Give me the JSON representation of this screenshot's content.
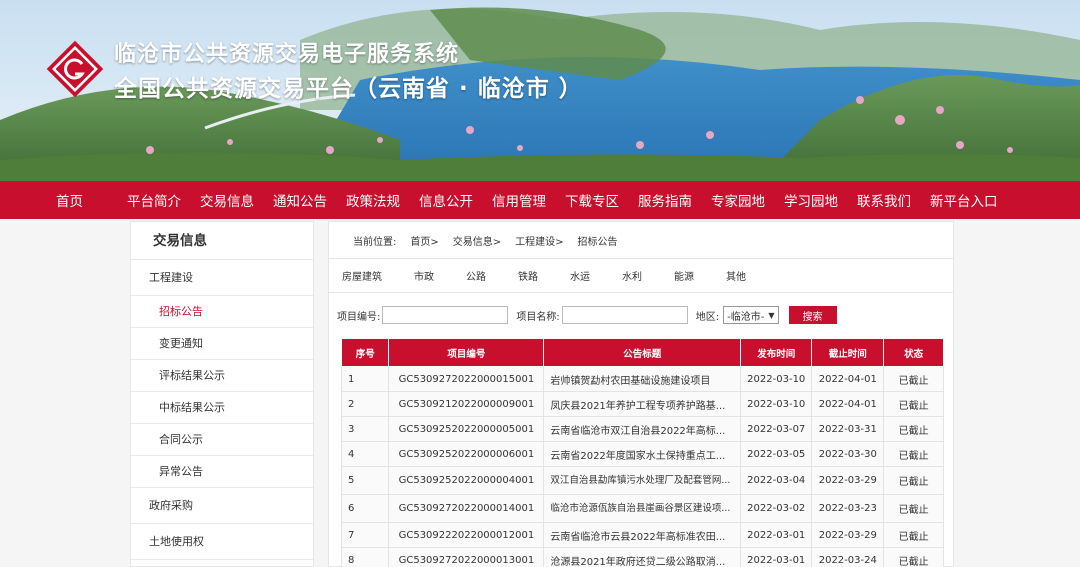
{
  "header": {
    "title_line1": "临沧市公共资源交易电子服务系统",
    "title_line2": "全国公共资源交易平台（云南省 · 临沧市 ）"
  },
  "nav": [
    "首页",
    "平台简介",
    "交易信息",
    "通知公告",
    "政策法规",
    "信息公开",
    "信用管理",
    "下载专区",
    "服务指南",
    "专家园地",
    "学习园地",
    "联系我们",
    "新平台入口"
  ],
  "sidebar": {
    "title": "交易信息",
    "items": [
      {
        "label": "工程建设",
        "type": "cat"
      },
      {
        "label": "招标公告",
        "type": "sub",
        "active": true
      },
      {
        "label": "变更通知",
        "type": "sub"
      },
      {
        "label": "评标结果公示",
        "type": "sub"
      },
      {
        "label": "中标结果公示",
        "type": "sub"
      },
      {
        "label": "合同公示",
        "type": "sub"
      },
      {
        "label": "异常公告",
        "type": "sub"
      },
      {
        "label": "政府采购",
        "type": "cat"
      },
      {
        "label": "土地使用权",
        "type": "cat"
      }
    ]
  },
  "breadcrumb": [
    "当前位置:",
    "首页>",
    "交易信息>",
    "工程建设>",
    "招标公告"
  ],
  "categories": [
    "房屋建筑",
    "市政",
    "公路",
    "铁路",
    "水运",
    "水利",
    "能源",
    "其他"
  ],
  "search": {
    "code_label": "项目编号:",
    "name_label": "项目名称:",
    "region_label": "地区:",
    "region_value": "-临沧市-",
    "button": "搜索"
  },
  "table": {
    "headers": [
      "序号",
      "项目编号",
      "公告标题",
      "发布时间",
      "截止时间",
      "状态"
    ],
    "rows": [
      [
        "1",
        "GC5309272022000015001",
        "岩帅镇贺勐村农田基础设施建设项目",
        "2022-03-10",
        "2022-04-01",
        "已截止"
      ],
      [
        "2",
        "GC5309212022000009001",
        "凤庆县2021年养护工程专项养护路基...",
        "2022-03-10",
        "2022-04-01",
        "已截止"
      ],
      [
        "3",
        "GC5309252022000005001",
        "云南省临沧市双江自治县2022年高标...",
        "2022-03-07",
        "2022-03-31",
        "已截止"
      ],
      [
        "4",
        "GC5309252022000006001",
        "云南省2022年度国家水土保持重点工...",
        "2022-03-05",
        "2022-03-30",
        "已截止"
      ],
      [
        "5",
        "GC5309252022000004001",
        "双江自治县勐库镇污水处理厂及配套管网...",
        "2022-03-04",
        "2022-03-29",
        "已截止"
      ],
      [
        "6",
        "GC5309272022000014001",
        "临沧市沧源佤族自治县崖画谷景区建设项...",
        "2022-03-02",
        "2022-03-23",
        "已截止"
      ],
      [
        "7",
        "GC5309222022000012001",
        "云南省临沧市云县2022年高标准农田...",
        "2022-03-01",
        "2022-03-29",
        "已截止"
      ],
      [
        "8",
        "GC5309272022000013001",
        "沧源县2021年政府还贷二级公路取消...",
        "2022-03-01",
        "2022-03-24",
        "已截止"
      ]
    ]
  },
  "colors": {
    "accent": "#c8102e"
  }
}
